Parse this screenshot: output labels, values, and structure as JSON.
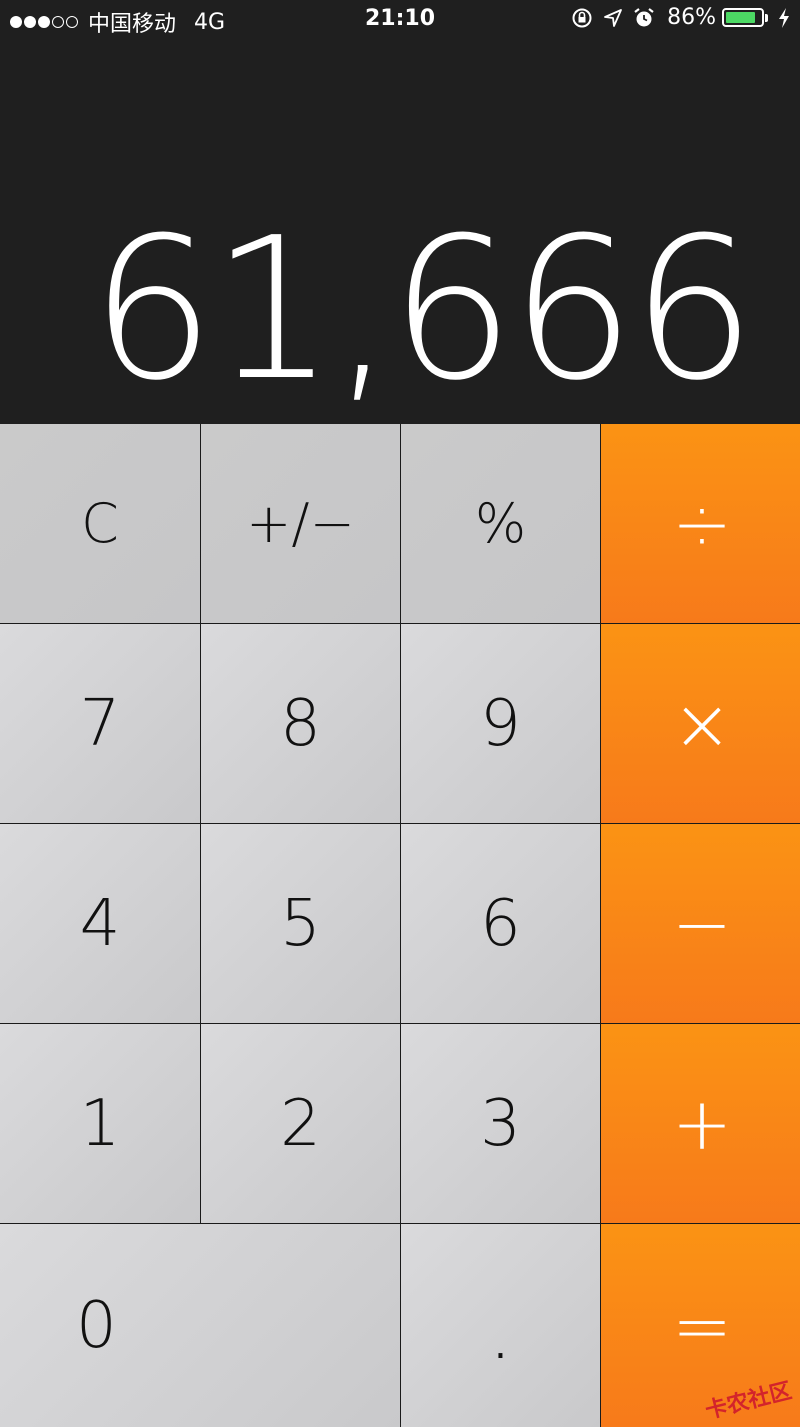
{
  "status_bar": {
    "carrier": "中国移动",
    "network": "4G",
    "time": "21:10",
    "battery_percent": "86%",
    "battery_level": 0.86,
    "signal_bars_filled": 3,
    "signal_bars_total": 5,
    "icons": [
      "orientation-lock-icon",
      "location-arrow-icon",
      "alarm-clock-icon",
      "battery-icon",
      "charging-bolt-icon"
    ]
  },
  "display": {
    "value": "61,666"
  },
  "keypad": {
    "clear": "C",
    "plus_minus": "+/−",
    "percent": "%",
    "divide": "÷",
    "multiply": "×",
    "subtract": "−",
    "add": "+",
    "equals": "=",
    "decimal": ".",
    "digits": [
      "0",
      "1",
      "2",
      "3",
      "4",
      "5",
      "6",
      "7",
      "8",
      "9"
    ]
  },
  "colors": {
    "display_bg": "#1f1f1f",
    "operator": "#f88a16",
    "function_key": "#c8c8ca",
    "number_key": "#d4d4d6",
    "battery_fill": "#4cd964"
  },
  "watermark": "卡农社区"
}
